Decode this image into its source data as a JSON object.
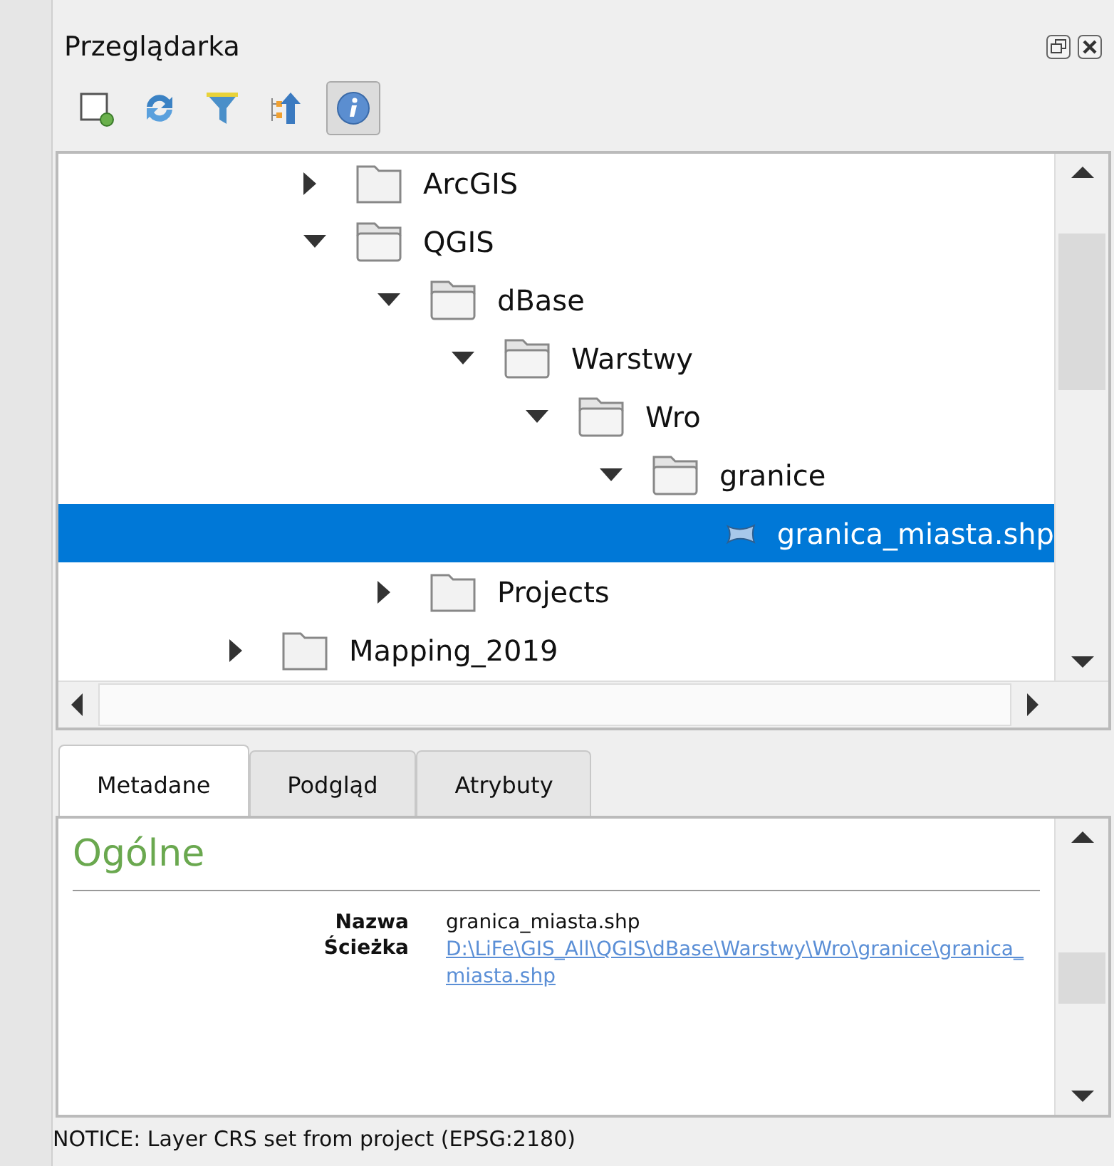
{
  "panel": {
    "title": "Przeglądarka"
  },
  "tree": {
    "items": [
      {
        "label": "ArcGIS",
        "kind": "folder",
        "expanded": false,
        "selected": false
      },
      {
        "label": "QGIS",
        "kind": "folder",
        "expanded": true,
        "selected": false,
        "children": [
          {
            "label": "dBase",
            "kind": "folder",
            "expanded": true,
            "selected": false,
            "children": [
              {
                "label": "Warstwy",
                "kind": "folder",
                "expanded": true,
                "selected": false,
                "children": [
                  {
                    "label": "Wro",
                    "kind": "folder",
                    "expanded": true,
                    "selected": false,
                    "children": [
                      {
                        "label": "granice",
                        "kind": "folder",
                        "expanded": true,
                        "selected": false,
                        "children": [
                          {
                            "label": "granica_miasta.shp",
                            "kind": "layer",
                            "selected": true
                          }
                        ]
                      }
                    ]
                  }
                ]
              }
            ]
          },
          {
            "label": "Projects",
            "kind": "folder",
            "expanded": false,
            "selected": false
          }
        ]
      }
    ],
    "outer_items": [
      {
        "label": "Mapping_2019",
        "kind": "folder",
        "expanded": false,
        "selected": false
      }
    ]
  },
  "tabs": [
    {
      "label": "Metadane",
      "selected": true
    },
    {
      "label": "Podgląd",
      "selected": false
    },
    {
      "label": "Atrybuty",
      "selected": false
    }
  ],
  "metadata": {
    "heading": "Ogólne",
    "fields": [
      {
        "label": "Nazwa",
        "value": "granica_miasta.shp",
        "kind": "text"
      },
      {
        "label": "Ścieżka",
        "value": "D:\\LiFe\\GIS_All\\QGIS\\dBase\\Warstwy\\Wro\\granice\\granica_miasta.shp",
        "kind": "link"
      }
    ]
  },
  "status_bar": {
    "message": "NOTICE: Layer CRS set from project (EPSG:2180)"
  }
}
